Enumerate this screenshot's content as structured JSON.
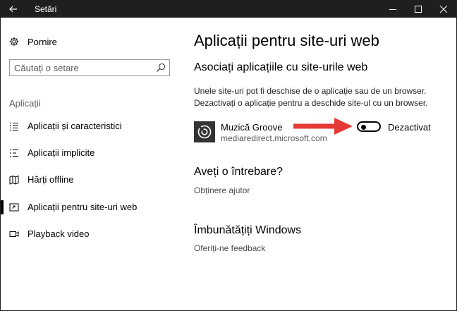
{
  "window": {
    "title": "Setări"
  },
  "sidebar": {
    "home_label": "Pornire",
    "search_placeholder": "Căutați o setare",
    "section_label": "Aplicații",
    "items": [
      {
        "label": "Aplicații și caracteristici",
        "icon": "list-icon"
      },
      {
        "label": "Aplicații implicite",
        "icon": "default-apps-icon"
      },
      {
        "label": "Hărți offline",
        "icon": "map-icon"
      },
      {
        "label": "Aplicații pentru site-uri web",
        "icon": "web-apps-icon",
        "selected": true
      },
      {
        "label": "Playback video",
        "icon": "video-icon"
      }
    ]
  },
  "main": {
    "title": "Aplicații pentru site-uri web",
    "subtitle": "Asociați aplicațiile cu site-urile web",
    "description_line1": "Unele site-uri pot fi deschise de o aplicație sau de un browser.",
    "description_line2": "Dezactivați o aplicație pentru a deschide site-ul cu un browser.",
    "app": {
      "name": "Muzică Groove",
      "domain": "mediaredirect.microsoft.com",
      "toggle_state": "off",
      "toggle_label": "Dezactivat"
    },
    "question_heading": "Aveți o întrebare?",
    "help_link": "Obținere ajutor",
    "improve_heading": "Îmbunătățiți Windows",
    "feedback_link": "Oferiți-ne feedback"
  },
  "colors": {
    "titlebar": "#1f1f1f",
    "arrow": "#e53935",
    "app_tile": "#333333"
  }
}
